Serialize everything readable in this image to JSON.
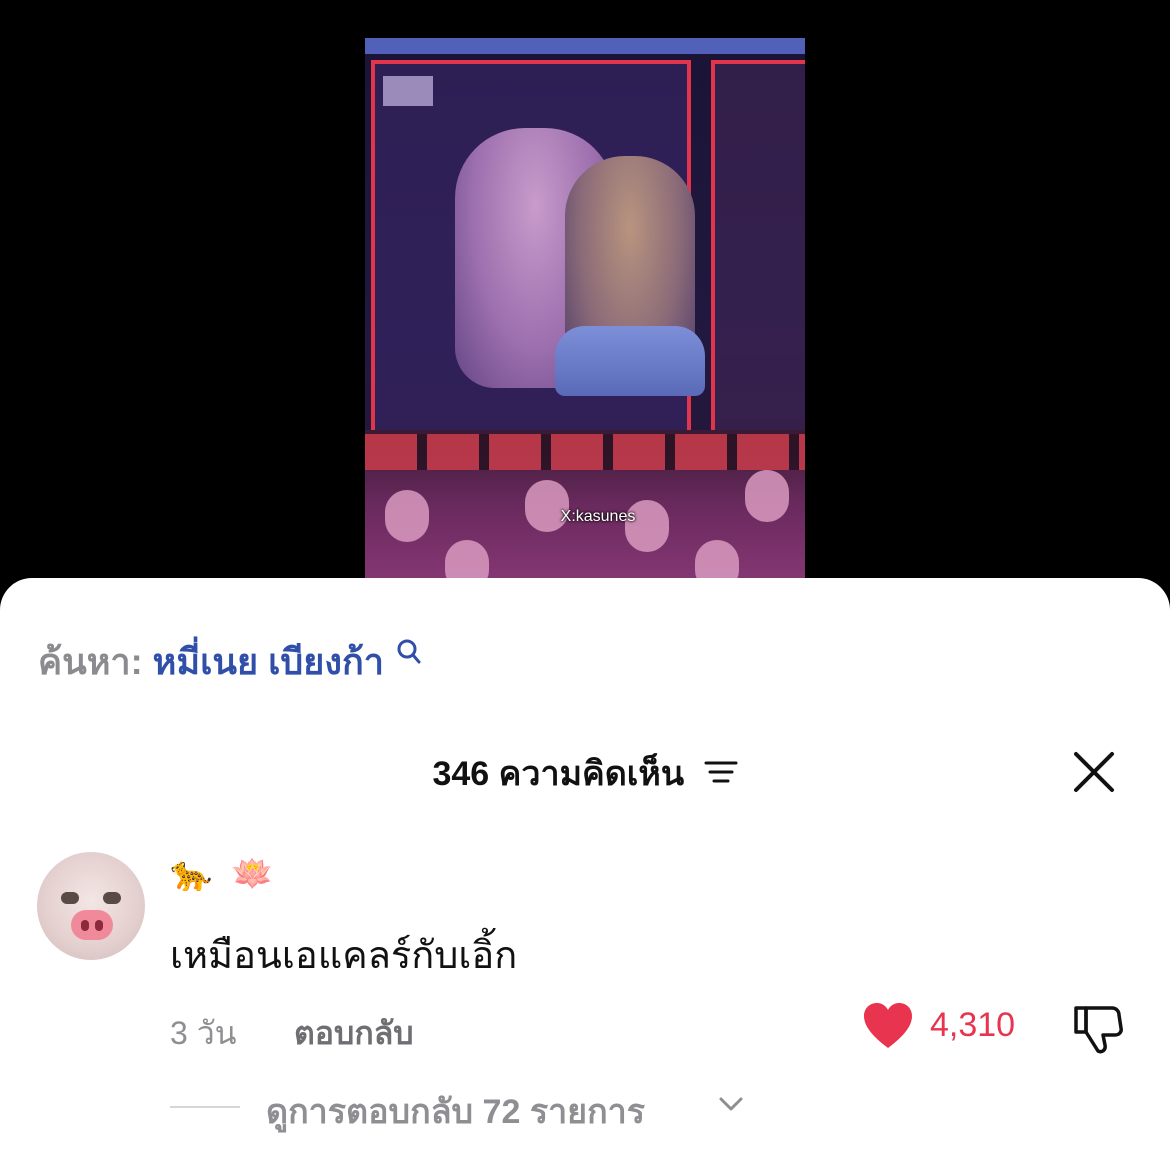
{
  "video": {
    "watermark": "X:kasunes"
  },
  "search": {
    "prefix": "ค้นหา:",
    "query": "หมี่เนย เบียงก้า",
    "icon": "search-icon"
  },
  "header": {
    "comment_count": "346",
    "comment_label": "ความคิดเห็น",
    "filter_icon": "filter-icon",
    "close_icon": "close-icon"
  },
  "comment": {
    "username_emoji": [
      "🐆",
      "🪷"
    ],
    "text": "เหมือนเอแคลร์กับเอิ้ก",
    "time": "3 วัน",
    "reply_label": "ตอบกลับ",
    "like_count": "4,310",
    "like_icon": "heart-icon",
    "dislike_icon": "thumbs-down-icon",
    "view_replies": "ดูการตอบกลับ 72 รายการ",
    "colors": {
      "like": "#e8344f",
      "search_query": "#2f4fa8",
      "muted": "#8e8e93"
    }
  }
}
